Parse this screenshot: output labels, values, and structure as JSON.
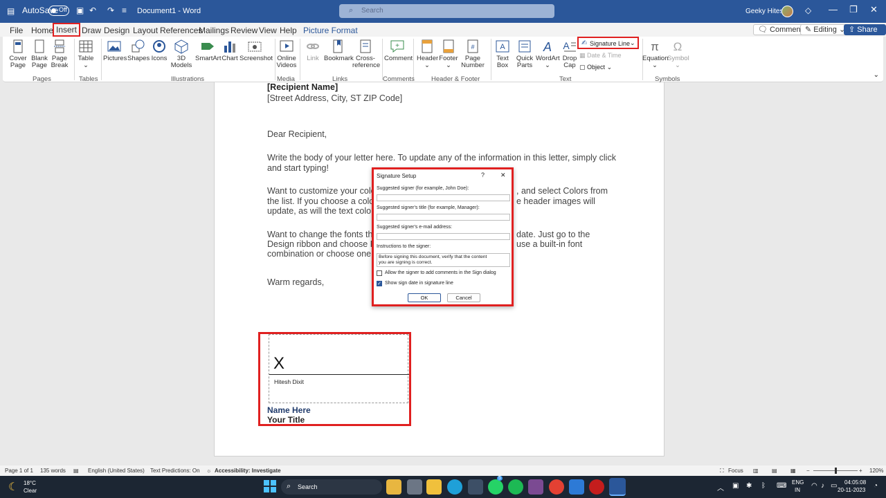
{
  "titlebar": {
    "autosave": "AutoSave",
    "toggle": "Off",
    "doc_title": "Document1 - Word",
    "search_placeholder": "Search",
    "user": "Geeky Hitesh"
  },
  "tabs": [
    "File",
    "Home",
    "Insert",
    "Draw",
    "Design",
    "Layout",
    "References",
    "Mailings",
    "Review",
    "View",
    "Help",
    "Picture Format"
  ],
  "active_tab": "Insert",
  "header_buttons": {
    "comments": "Comments",
    "editing": "Editing",
    "share": "Share"
  },
  "ribbon": {
    "items": [
      {
        "label": "Cover\nPage",
        "icon": "cover-page-icon"
      },
      {
        "label": "Blank\nPage",
        "icon": "blank-page-icon"
      },
      {
        "label": "Page\nBreak",
        "icon": "page-break-icon"
      },
      {
        "label": "Table",
        "icon": "table-icon"
      },
      {
        "label": "Pictures",
        "icon": "pictures-icon"
      },
      {
        "label": "Shapes",
        "icon": "shapes-icon"
      },
      {
        "label": "Icons",
        "icon": "icons-icon"
      },
      {
        "label": "3D\nModels",
        "icon": "3d-models-icon"
      },
      {
        "label": "SmartArt",
        "icon": "smartart-icon"
      },
      {
        "label": "Chart",
        "icon": "chart-icon"
      },
      {
        "label": "Screenshot",
        "icon": "screenshot-icon"
      },
      {
        "label": "Online\nVideos",
        "icon": "online-videos-icon"
      },
      {
        "label": "Link",
        "icon": "link-icon"
      },
      {
        "label": "Bookmark",
        "icon": "bookmark-icon"
      },
      {
        "label": "Cross-\nreference",
        "icon": "cross-reference-icon"
      },
      {
        "label": "Comment",
        "icon": "comment-icon"
      },
      {
        "label": "Header",
        "icon": "header-icon"
      },
      {
        "label": "Footer",
        "icon": "footer-icon"
      },
      {
        "label": "Page\nNumber",
        "icon": "page-number-icon"
      },
      {
        "label": "Text\nBox",
        "icon": "text-box-icon"
      },
      {
        "label": "Quick\nParts",
        "icon": "quick-parts-icon"
      },
      {
        "label": "WordArt",
        "icon": "wordart-icon"
      },
      {
        "label": "Drop\nCap",
        "icon": "drop-cap-icon"
      },
      {
        "label": "Equation",
        "icon": "equation-icon"
      },
      {
        "label": "Symbol",
        "icon": "symbol-icon"
      }
    ],
    "small": {
      "signature_line": "Signature Line",
      "date_time": "Date & Time",
      "object": "Object"
    },
    "groups": [
      "Pages",
      "Tables",
      "Illustrations",
      "Media",
      "Links",
      "Comments",
      "Header & Footer",
      "Text",
      "Symbols"
    ]
  },
  "document": {
    "recipient_name": "[Recipient Name]",
    "address": "[Street Address, City, ST ZIP Code]",
    "greeting": "Dear Recipient,",
    "p1_l1": "Write the body of your letter here.  To update any of the information in this letter, simply click",
    "p1_l2": "and start typing!",
    "p2_l1": "Want to customize your colo",
    "p2_l1b": ", and select Colors from",
    "p2_l2": "the list.  If you choose a colo",
    "p2_l2b": "e header images will",
    "p2_l3": "update, as will the text color",
    "p3_l1": "Want to change the fonts tha",
    "p3_l1b": "date.  Just go to the",
    "p3_l2": "Design ribbon and choose F",
    "p3_l2b": "use a built-in font",
    "p3_l3": "combination or choose one o",
    "closing": "Warm regards,",
    "sig_x": "X",
    "sig_name": "Hitesh Dixit",
    "name_here": "Name Here",
    "your_title": "Your Title"
  },
  "dialog": {
    "title": "Signature Setup",
    "help": "?",
    "l1": "Suggested signer (for example, John Doe):",
    "l2": "Suggested signer's title (for example, Manager):",
    "l3": "Suggested signer's e-mail address:",
    "l4": "Instructions to the signer:",
    "instructions": "Before signing this document, verify that the content\nyou are signing is correct.",
    "c1": "Allow the signer to add comments in the Sign dialog",
    "c2": "Show sign date in signature line",
    "c1_checked": false,
    "c2_checked": true,
    "ok": "OK",
    "cancel": "Cancel"
  },
  "status": {
    "page": "Page 1 of 1",
    "words": "135 words",
    "lang": "English (United States)",
    "predictions": "Text Predictions: On",
    "access": "Accessibility: Investigate",
    "focus": "Focus",
    "zoom": "120%"
  },
  "taskbar": {
    "temp": "18°C",
    "weather": "Clear",
    "search": "Search",
    "lang1": "ENG",
    "lang2": "IN",
    "time": "04:05:08",
    "date": "20-11-2023",
    "badge": "5"
  }
}
